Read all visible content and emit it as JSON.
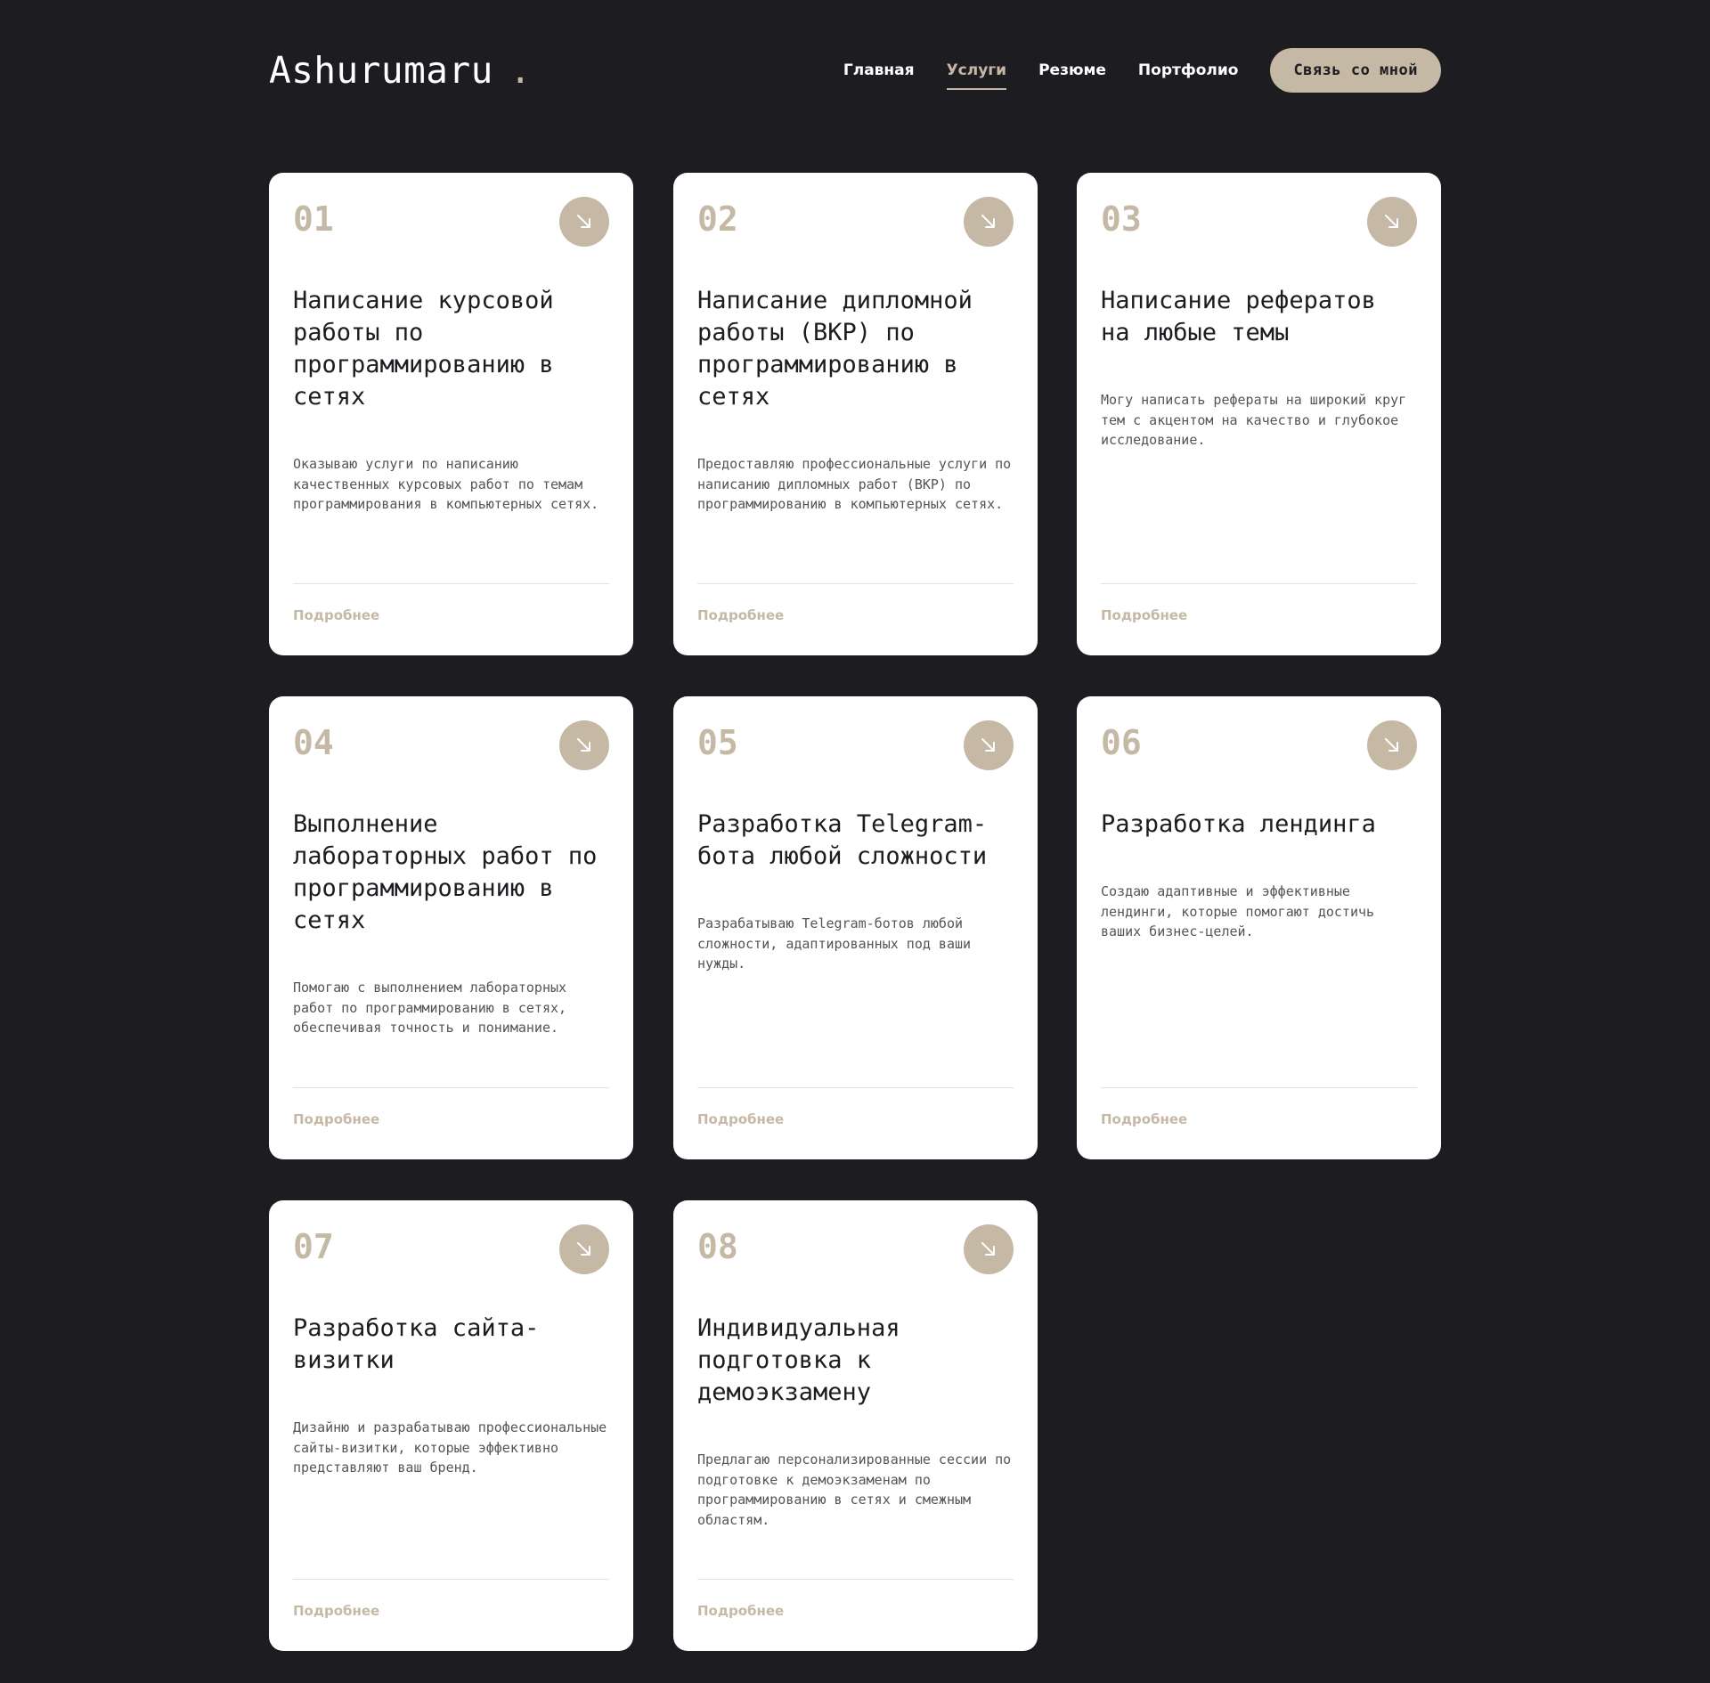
{
  "header": {
    "logo": "Ashurumaru",
    "logo_dot": ".",
    "nav": [
      {
        "label": "Главная",
        "active": false
      },
      {
        "label": "Услуги",
        "active": true
      },
      {
        "label": "Резюме",
        "active": false
      },
      {
        "label": "Портфолио",
        "active": false
      }
    ],
    "cta_label": "Связь со мной"
  },
  "colors": {
    "background": "#1d1c21",
    "accent": "#c5b9a6",
    "card": "#ffffff"
  },
  "services": [
    {
      "num": "01",
      "icon": "arrow-down-right-icon",
      "title": "Написание курсовой работы по программированию в сетях",
      "desc": "Оказываю услуги по написанию качественных курсовых работ по темам программирования в компьютерных сетях.",
      "more": "Подробнее"
    },
    {
      "num": "02",
      "icon": "arrow-down-right-icon",
      "title": "Написание дипломной работы (ВКР) по программированию в сетях",
      "desc": "Предоставляю профессиональные услуги по написанию дипломных работ (ВКР) по программированию в компьютерных сетях.",
      "more": "Подробнее"
    },
    {
      "num": "03",
      "icon": "arrow-down-right-icon",
      "title": "Написание рефератов на любые темы",
      "desc": "Могу написать рефераты на широкий круг тем с акцентом на качество и глубокое исследование.",
      "more": "Подробнее"
    },
    {
      "num": "04",
      "icon": "arrow-down-right-icon",
      "title": "Выполнение лабораторных работ по программированию в сетях",
      "desc": "Помогаю с выполнением лабораторных работ по программированию в сетях, обеспечивая точность и понимание.",
      "more": "Подробнее"
    },
    {
      "num": "05",
      "icon": "arrow-down-right-icon",
      "title": "Разработка Telegram-бота любой сложности",
      "desc": "Разрабатываю Telegram-ботов любой сложности, адаптированных под ваши нужды.",
      "more": "Подробнее"
    },
    {
      "num": "06",
      "icon": "arrow-down-right-icon",
      "title": "Разработка лендинга",
      "desc": "Создаю адаптивные и эффективные лендинги, которые помогают достичь ваших бизнес-целей.",
      "more": "Подробнее"
    },
    {
      "num": "07",
      "icon": "arrow-down-right-icon",
      "title": "Разработка сайта-визитки",
      "desc": "Дизайню и разрабатываю профессиональные сайты-визитки, которые эффективно представляют ваш бренд.",
      "more": "Подробнее"
    },
    {
      "num": "08",
      "icon": "arrow-down-right-icon",
      "title": "Индивидуальная подготовка к демоэкзамену",
      "desc": "Предлагаю персонализированные сессии по подготовке к демоэкзаменам по программированию в сетях и смежным областям.",
      "more": "Подробнее"
    }
  ]
}
